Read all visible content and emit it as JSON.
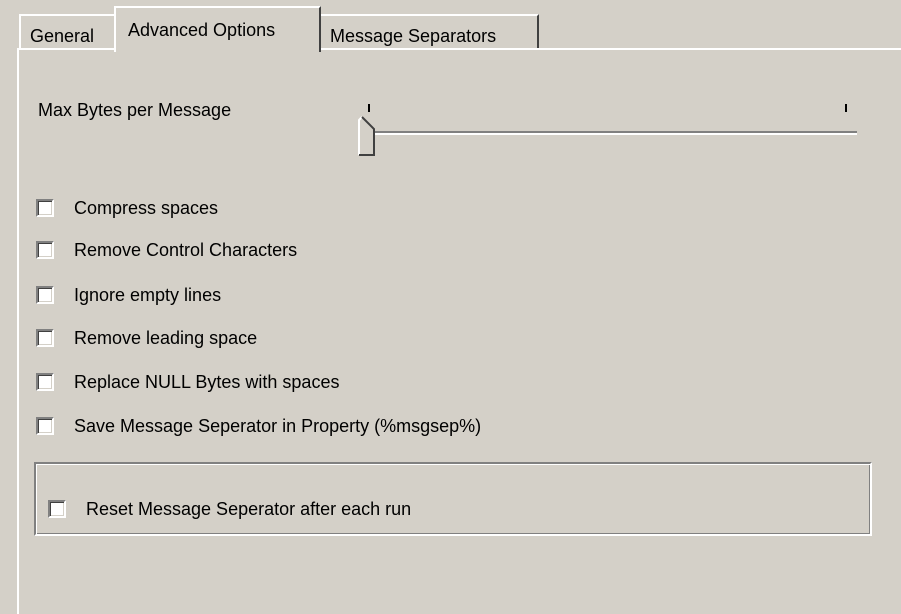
{
  "tabs": [
    {
      "label": "General",
      "selected": false
    },
    {
      "label": "Advanced Options",
      "selected": true
    },
    {
      "label": "Message Separators",
      "selected": false
    }
  ],
  "max_bytes": {
    "label": "Max Bytes per Message",
    "slider_value": 0
  },
  "options": [
    {
      "label": "Compress spaces",
      "checked": false
    },
    {
      "label": "Remove Control Characters",
      "checked": false
    },
    {
      "label": "Ignore empty lines",
      "checked": false
    },
    {
      "label": "Remove leading space",
      "checked": false
    },
    {
      "label": "Replace NULL Bytes with spaces",
      "checked": false
    },
    {
      "label": "Save Message Seperator in Property (%msgsep%)",
      "checked": false
    }
  ],
  "group": {
    "reset_option": {
      "label": "Reset Message Seperator after each run",
      "checked": false
    }
  }
}
